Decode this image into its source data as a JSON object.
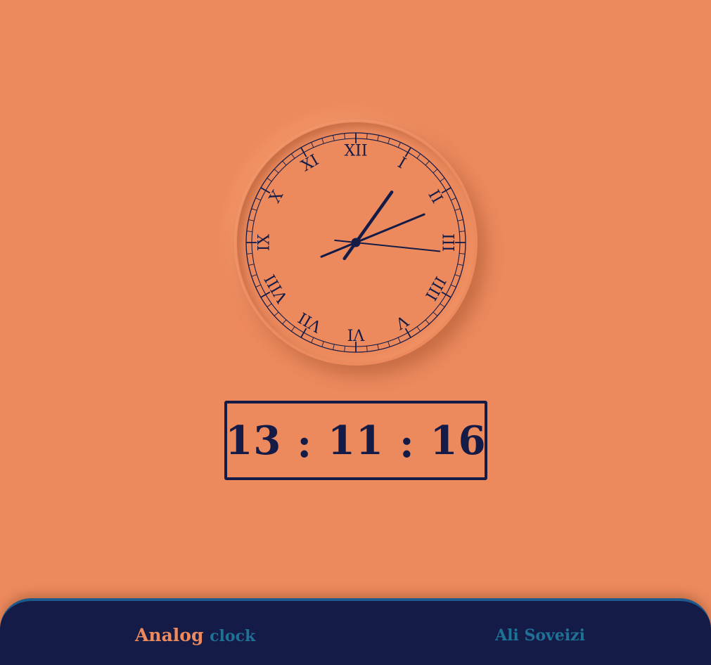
{
  "clock": {
    "numerals": [
      "XII",
      "I",
      "II",
      "III",
      "IIII",
      "V",
      "VI",
      "VII",
      "VIII",
      "IX",
      "X",
      "XI"
    ],
    "time": {
      "hours": 13,
      "minutes": 11,
      "seconds": 16
    }
  },
  "digital": {
    "hours": "13",
    "minutes": "11",
    "seconds": "16",
    "separator": ":"
  },
  "footer": {
    "title_primary": "Analog",
    "title_secondary": "clock",
    "author": "Ali Soveizi"
  },
  "colors": {
    "background": "#ec8a5e",
    "ink": "#141b47",
    "accent": "#1f7196"
  }
}
